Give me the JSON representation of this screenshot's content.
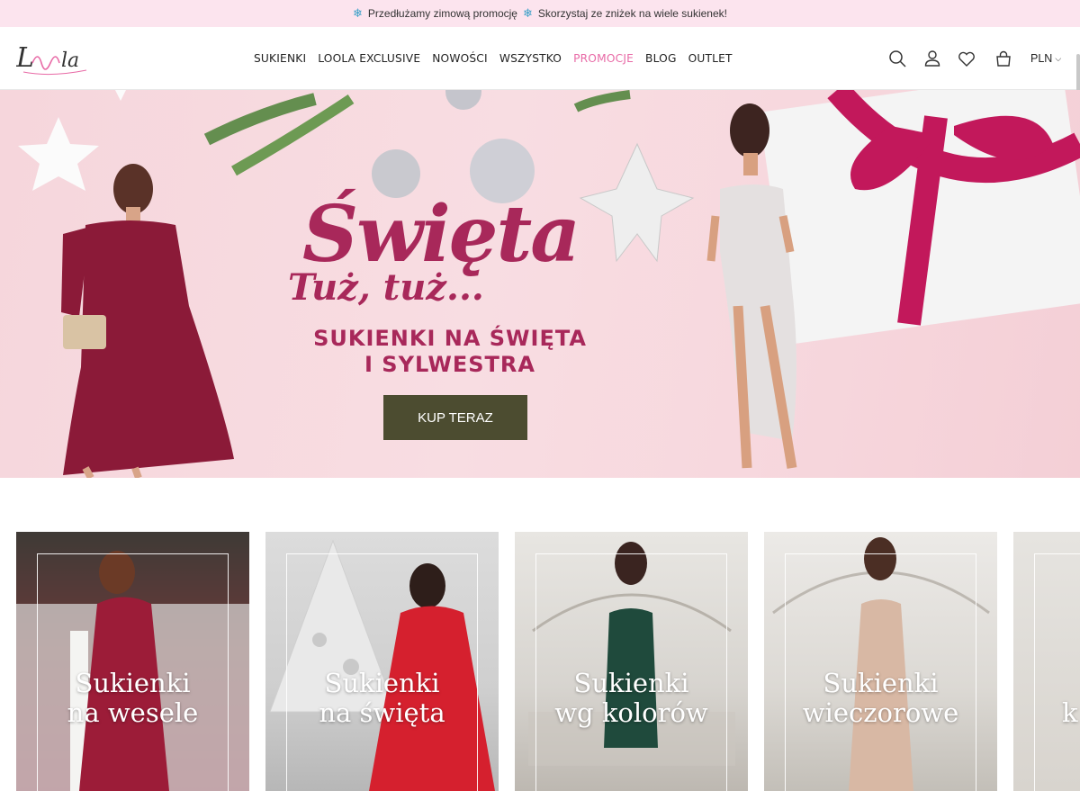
{
  "promo": {
    "text": "Przedłużamy zimową promocję",
    "text2": "Skorzystaj ze zniżek na wiele sukienek!"
  },
  "header": {
    "logo": "Loola",
    "nav": [
      {
        "label": "SUKIENKI"
      },
      {
        "label": "LOOLA EXCLUSIVE"
      },
      {
        "label": "NOWOŚCI"
      },
      {
        "label": "WSZYSTKO"
      },
      {
        "label": "PROMOCJE",
        "highlight": true
      },
      {
        "label": "BLOG"
      },
      {
        "label": "OUTLET"
      }
    ],
    "currency": "PLN",
    "icons": [
      "search-icon",
      "user-icon",
      "heart-icon",
      "bag-icon"
    ]
  },
  "hero": {
    "title": "Święta",
    "subtitle": "Tuż, tuż...",
    "headline": "SUKIENKI NA ŚWIĘTA I SYLWESTRA",
    "button": "KUP TERAZ",
    "colors": {
      "accent": "#a8285a",
      "button": "#4c4c30",
      "promo": "#e86aa6"
    }
  },
  "categories": [
    {
      "line1": "Sukienki",
      "line2": "na wesele"
    },
    {
      "line1": "Sukienki",
      "line2": "na święta"
    },
    {
      "line1": "Sukienki",
      "line2": "wg kolorów"
    },
    {
      "line1": "Sukienki",
      "line2": "wieczorowe"
    },
    {
      "line1": "",
      "line2": "k"
    }
  ]
}
